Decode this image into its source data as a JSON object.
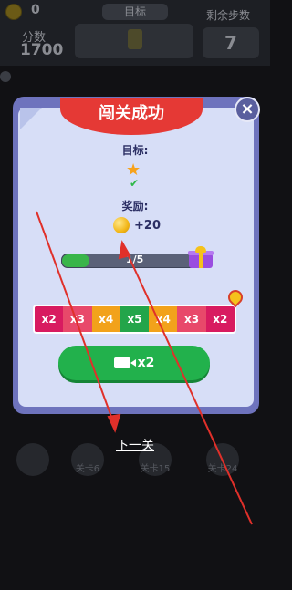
{
  "hud": {
    "coins": "0",
    "score_label": "分数",
    "score_value": "1700",
    "goal_tab": "目标",
    "steps_label": "剩余步数",
    "steps_value": "7"
  },
  "modal": {
    "title": "闯关成功",
    "close_symbol": "×",
    "goal_label": "目标:",
    "reward_label": "奖励:",
    "reward_value": "+20",
    "progress_text": "1/5",
    "progress_fraction": 0.2,
    "multipliers": [
      {
        "label": "x2",
        "color": "#d81b60"
      },
      {
        "label": "x3",
        "color": "#e8496a"
      },
      {
        "label": "x4",
        "color": "#f2a21b"
      },
      {
        "label": "x5",
        "color": "#23a54a"
      },
      {
        "label": "x4",
        "color": "#f2a21b"
      },
      {
        "label": "x3",
        "color": "#e8496a"
      },
      {
        "label": "x2",
        "color": "#d81b60"
      }
    ],
    "watch_label": "x2"
  },
  "next_level": "下一关",
  "tools": [
    {
      "label": ""
    },
    {
      "label": "关卡6"
    },
    {
      "label": "关卡15"
    },
    {
      "label": "关卡24"
    }
  ],
  "colors": {
    "ribbon": "#e53935",
    "modal_border": "#6e73bd",
    "button_green": "#22b14c"
  }
}
